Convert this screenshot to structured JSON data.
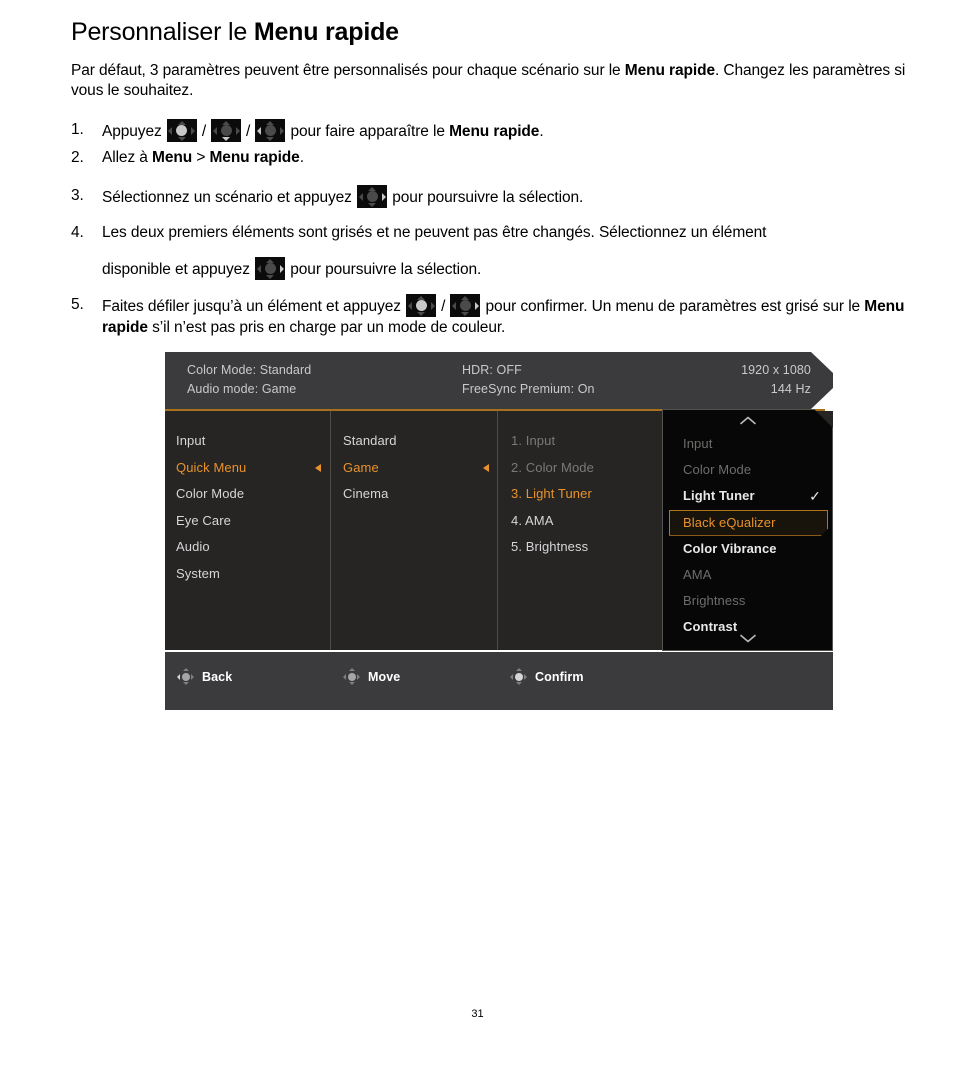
{
  "document": {
    "title_plain": "Personnaliser le ",
    "title_bold": "Menu rapide",
    "intro_1": "Par défaut, 3 paramètres peuvent être personnalisés pour chaque scénario sur le ",
    "intro_bold": "Menu rapide",
    "intro_2": ". Changez les paramètres si vous le souhaitez.",
    "page_number": "31",
    "steps": [
      {
        "num": "1.",
        "text_a": "Appuyez ",
        "text_b": " pour faire apparaître le ",
        "bold": "Menu rapide",
        "text_c": "."
      },
      {
        "num": "2.",
        "text_a": "Allez à ",
        "bold_a": "Menu",
        "text_b": " > ",
        "bold_b": "Menu rapide",
        "text_c": "."
      },
      {
        "num": "3.",
        "text_a": "Sélectionnez un scénario et appuyez ",
        "text_b": " pour poursuivre la sélection."
      },
      {
        "num": "4.",
        "text_a": "Les deux premiers éléments sont grisés et ne peuvent pas être changés. Sélectionnez un élément",
        "text_b": "disponible et appuyez ",
        "text_c": " pour poursuivre la sélection."
      },
      {
        "num": "5.",
        "text_a": "Faites défiler jusqu’à un élément et appuyez ",
        "text_b": " pour confirmer. Un menu de paramètres est grisé sur le ",
        "bold": "Menu rapide",
        "text_c": " s’il n’est pas pris en charge par un mode de couleur."
      }
    ],
    "separator": "/"
  },
  "osd": {
    "header": {
      "color_mode": "Color Mode: Standard",
      "audio_mode": "Audio mode: Game",
      "hdr": "HDR: OFF",
      "freesync": "FreeSync Premium: On",
      "resolution": "1920 x 1080",
      "refresh": "144 Hz"
    },
    "column1": [
      {
        "label": "Input",
        "state": "normal",
        "arrow": false
      },
      {
        "label": "Quick Menu",
        "state": "selected",
        "arrow": true
      },
      {
        "label": "Color Mode",
        "state": "normal",
        "arrow": false
      },
      {
        "label": "Eye Care",
        "state": "normal",
        "arrow": false
      },
      {
        "label": "Audio",
        "state": "normal",
        "arrow": false
      },
      {
        "label": "System",
        "state": "normal",
        "arrow": false
      }
    ],
    "column2": [
      {
        "label": "Standard",
        "state": "normal",
        "arrow": false
      },
      {
        "label": "Game",
        "state": "selected",
        "arrow": true
      },
      {
        "label": "Cinema",
        "state": "normal",
        "arrow": false
      }
    ],
    "column3": [
      {
        "label": "1. Input",
        "state": "disabled"
      },
      {
        "label": "2. Color Mode",
        "state": "disabled"
      },
      {
        "label": "3. Light Tuner",
        "state": "selected"
      },
      {
        "label": "4. AMA",
        "state": "normal"
      },
      {
        "label": "5. Brightness",
        "state": "normal"
      }
    ],
    "column4": [
      {
        "label": "Input",
        "state": "disabled",
        "check": false,
        "highlight": false
      },
      {
        "label": "Color Mode",
        "state": "disabled",
        "check": false,
        "highlight": false
      },
      {
        "label": "Light Tuner",
        "state": "normal",
        "check": true,
        "highlight": false
      },
      {
        "label": "Black eQualizer",
        "state": "normal",
        "check": false,
        "highlight": true
      },
      {
        "label": "Color Vibrance",
        "state": "normal",
        "check": false,
        "highlight": false
      },
      {
        "label": "AMA",
        "state": "disabled",
        "check": false,
        "highlight": false
      },
      {
        "label": "Brightness",
        "state": "disabled",
        "check": false,
        "highlight": false
      },
      {
        "label": "Contrast",
        "state": "normal",
        "check": false,
        "highlight": false
      }
    ],
    "column4_checkmark": "✓",
    "footer": [
      {
        "label": "Back",
        "icon": "dpad-left-icon"
      },
      {
        "label": "Move",
        "icon": "dpad-updown-icon"
      },
      {
        "label": "Confirm",
        "icon": "dpad-center-icon"
      }
    ]
  },
  "colors": {
    "accent_orange": "#e8922b",
    "header_bg": "#3b3b3d",
    "body_bg": "#262523",
    "panel_dark": "#070707",
    "divider": "#4e4d4b",
    "accent_line": "#a8711c",
    "disabled_text": "#7a7977"
  }
}
